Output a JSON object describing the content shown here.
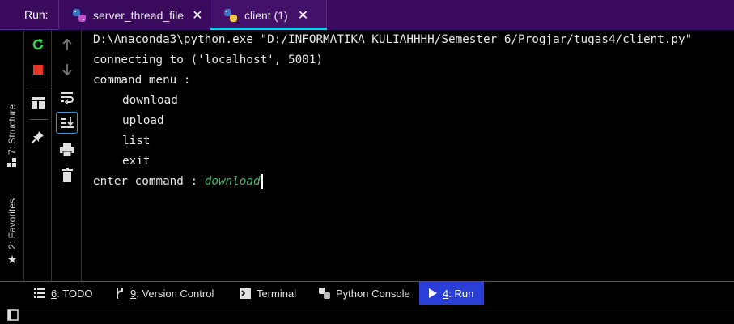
{
  "run_panel": {
    "label": "Run:",
    "tabs": [
      {
        "label": "server_thread_file",
        "icon": "python-icon",
        "close": "✕",
        "active": false
      },
      {
        "label": "client (1)",
        "icon": "python-icon",
        "close": "✕",
        "active": true
      }
    ]
  },
  "side_tabs": [
    {
      "label": "7: Structure",
      "icon": "structure-icon"
    },
    {
      "label": "2: Favorites",
      "icon": "star-icon"
    }
  ],
  "toolbar": {
    "left": [
      "rerun-icon",
      "stop-icon",
      "layout-icon",
      "pin-icon"
    ],
    "right": [
      "up-arrow-icon",
      "down-arrow-icon",
      "soft-wrap-icon",
      "scroll-to-end-icon",
      "print-icon",
      "trash-icon"
    ]
  },
  "console": {
    "lines": [
      "D:\\Anaconda3\\python.exe \"D:/INFORMATIKA KULIAHHHH/Semester 6/Progjar/tugas4/client.py\"",
      "connecting to ('localhost', 5001)",
      "command menu :",
      "download",
      "upload",
      "list",
      "exit"
    ],
    "prompt": "enter command : ",
    "user_input": "download"
  },
  "bottom_tabs": [
    {
      "key": "6",
      "label": ": TODO",
      "icon": "list-icon"
    },
    {
      "key": "9",
      "label": ": Version Control",
      "icon": "branch-icon"
    },
    {
      "key": "",
      "label": "Terminal",
      "icon": "terminal-icon"
    },
    {
      "key": "",
      "label": "Python Console",
      "icon": "python-console-icon"
    },
    {
      "key": "4",
      "label": ": Run",
      "icon": "run-icon",
      "active": true
    }
  ],
  "colors": {
    "tab_bar": "#3a0a5c",
    "active_tab_underline": "#22c4e6",
    "active_bottom_tab": "#2a3fd8",
    "user_input": "#46b36b",
    "rerun_green": "#3bd14f",
    "stop_red": "#e8352c"
  }
}
